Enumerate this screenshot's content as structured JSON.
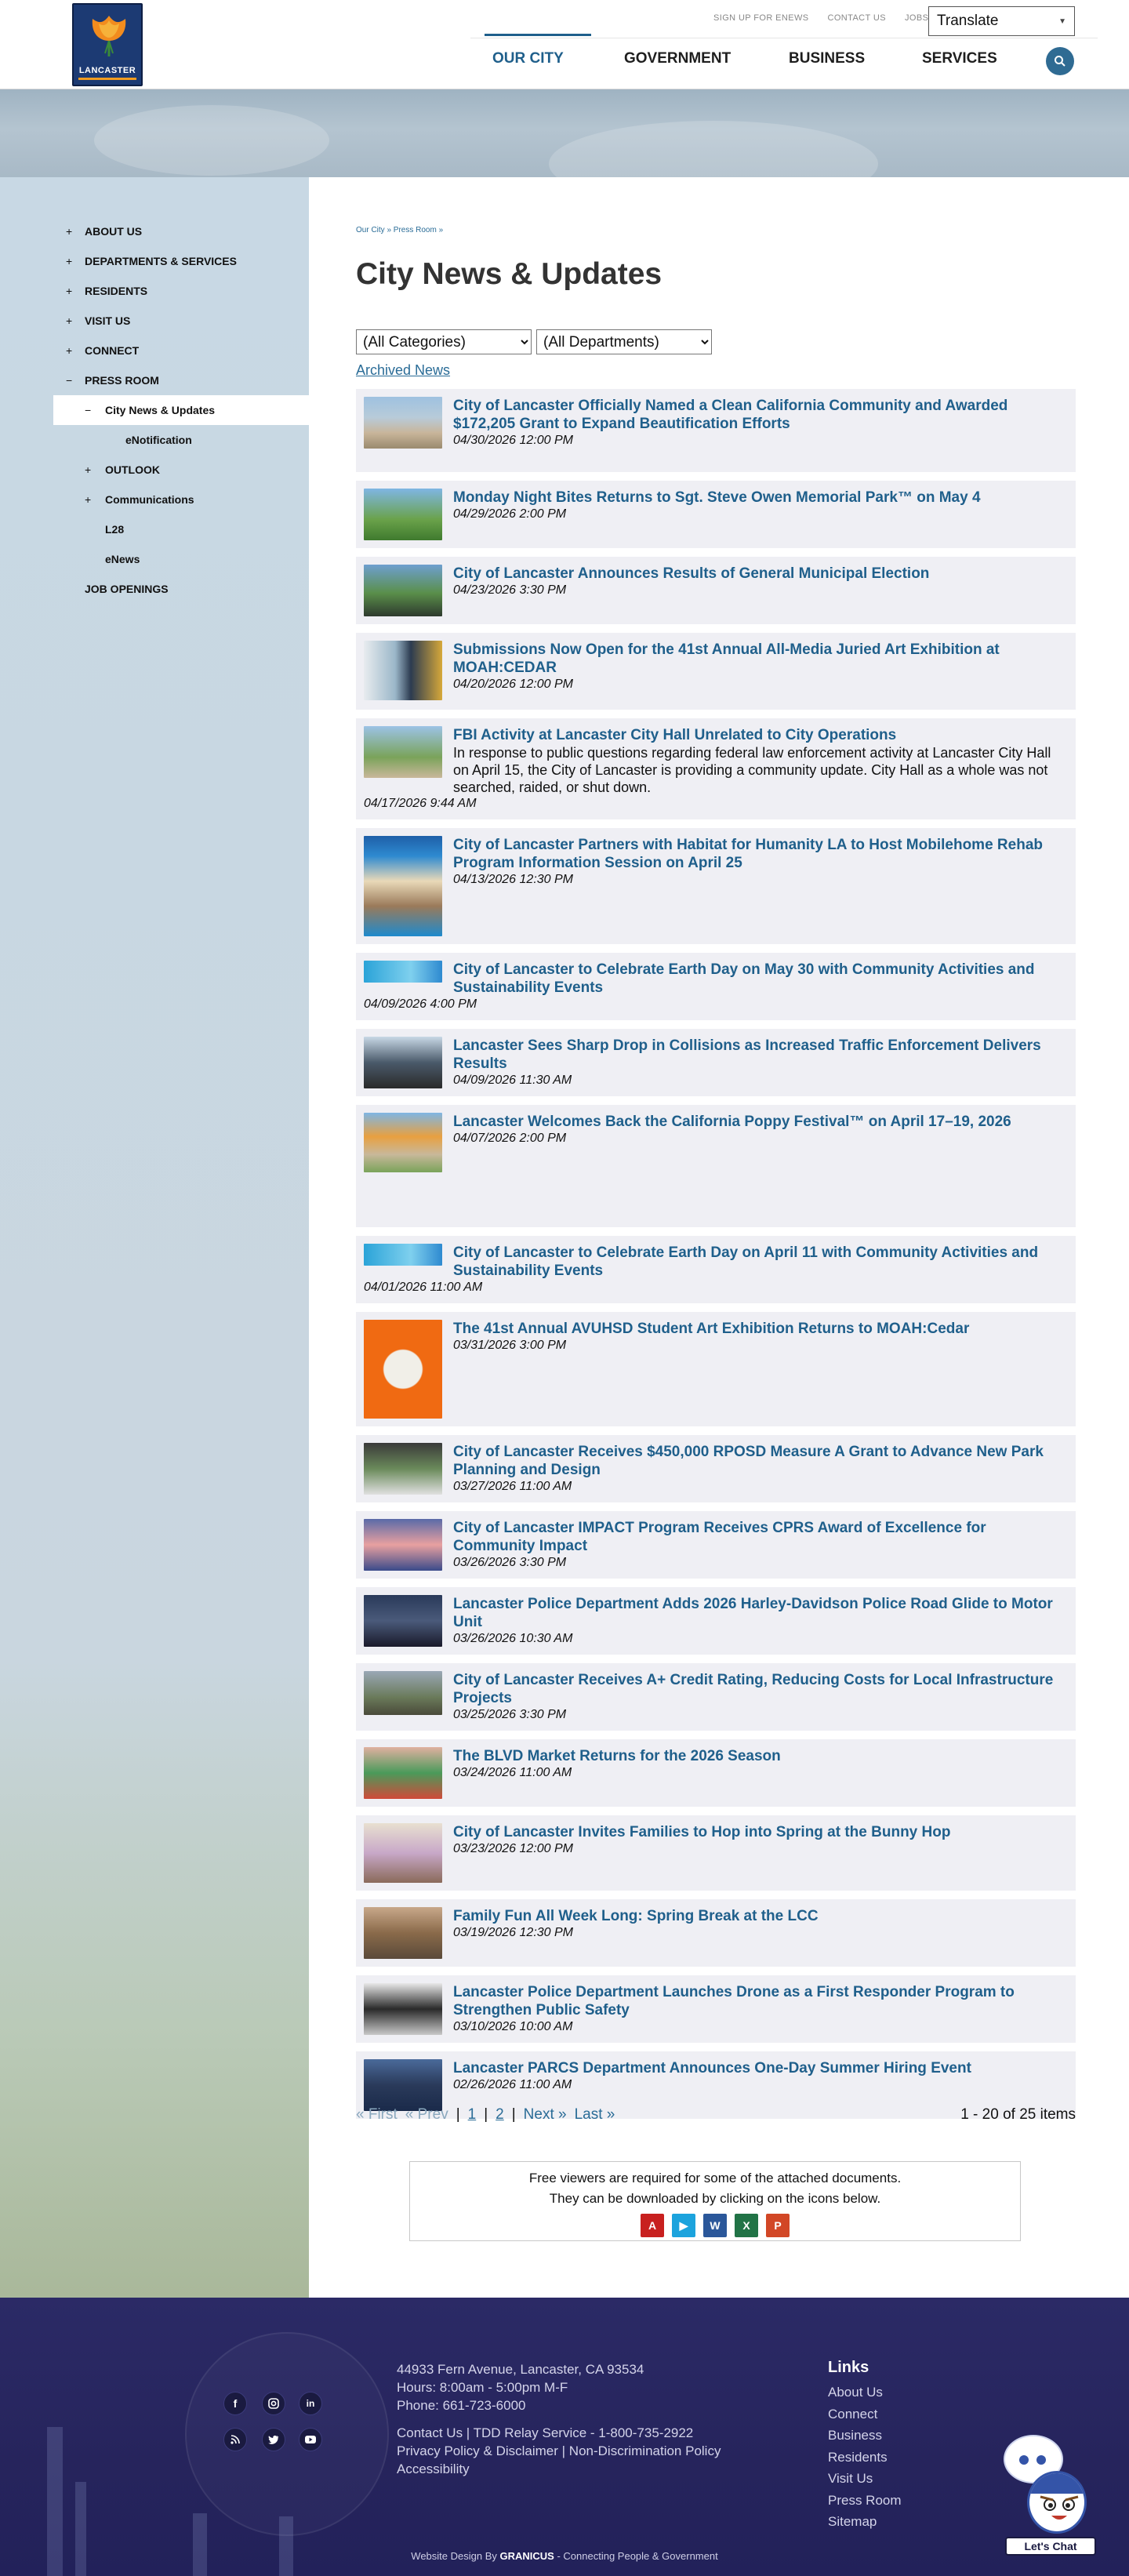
{
  "header": {
    "logo_text": "LANCASTER",
    "util_links": [
      "SIGN UP FOR ENEWS",
      "CONTACT US",
      "JOBS"
    ],
    "translate_label": "Translate",
    "nav": [
      "OUR CITY",
      "GOVERNMENT",
      "BUSINESS",
      "SERVICES"
    ],
    "search_icon": "search-icon"
  },
  "sidebar": {
    "items": [
      {
        "pm": "+",
        "label": "ABOUT US"
      },
      {
        "pm": "+",
        "label": "DEPARTMENTS & SERVICES"
      },
      {
        "pm": "+",
        "label": "RESIDENTS"
      },
      {
        "pm": "+",
        "label": "VISIT US"
      },
      {
        "pm": "+",
        "label": "CONNECT"
      },
      {
        "pm": "−",
        "label": "PRESS ROOM"
      },
      {
        "pm": "−",
        "label": "City News & Updates"
      },
      {
        "pm": "",
        "label": "eNotification"
      },
      {
        "pm": "+",
        "label": "OUTLOOK"
      },
      {
        "pm": "+",
        "label": "Communications"
      },
      {
        "pm": "",
        "label": "L28"
      },
      {
        "pm": "",
        "label": "eNews"
      },
      {
        "pm": "",
        "label": "JOB OPENINGS"
      }
    ]
  },
  "content": {
    "breadcrumb": "Our City » Press Room »",
    "title": "City News & Updates",
    "filter_categories": "(All Categories)",
    "filter_departments": "(All Departments)",
    "archived_label": "Archived News",
    "news": [
      {
        "title": "City of Lancaster Officially Named a Clean California Community and Awarded $172,205 Grant to Expand Beautification Efforts",
        "date": "04/30/2026 12:00 PM",
        "desc": ""
      },
      {
        "title": "Monday Night Bites Returns to Sgt. Steve Owen Memorial Park™ on May 4",
        "date": "04/29/2026 2:00 PM",
        "desc": ""
      },
      {
        "title": "City of Lancaster Announces Results of General Municipal Election",
        "date": "04/23/2026 3:30 PM",
        "desc": ""
      },
      {
        "title": "Submissions Now Open for the 41st Annual All-Media Juried Art Exhibition at MOAH:CEDAR",
        "date": "04/20/2026 12:00 PM",
        "desc": ""
      },
      {
        "title": "FBI Activity at Lancaster City Hall Unrelated to City Operations",
        "date": "04/17/2026 9:44 AM",
        "desc": "In response to public questions regarding federal law enforcement activity at Lancaster City Hall on April 15, the City of Lancaster is providing a community update. City Hall as a whole was not searched, raided, or shut down."
      },
      {
        "title": "City of Lancaster Partners with Habitat for Humanity LA to Host Mobilehome Rehab Program Information Session on April 25",
        "date": "04/13/2026 12:30 PM",
        "desc": ""
      },
      {
        "title": "City of Lancaster to Celebrate Earth Day on May 30 with Community Activities and Sustainability Events",
        "date": "04/09/2026 4:00 PM",
        "desc": ""
      },
      {
        "title": "Lancaster Sees Sharp Drop in Collisions as Increased Traffic Enforcement Delivers Results",
        "date": "04/09/2026 11:30 AM",
        "desc": ""
      },
      {
        "title": "Lancaster Welcomes Back the California Poppy Festival™ on April 17–19, 2026",
        "date": "04/07/2026 2:00 PM",
        "desc": ""
      },
      {
        "title": "City of Lancaster to Celebrate Earth Day on April 11 with Community Activities and Sustainability Events",
        "date": "04/01/2026 11:00 AM",
        "desc": ""
      },
      {
        "title": "The 41st Annual AVUHSD Student Art Exhibition Returns to MOAH:Cedar",
        "date": "03/31/2026 3:00 PM",
        "desc": ""
      },
      {
        "title": "City of Lancaster Receives $450,000 RPOSD Measure A Grant to Advance New Park Planning and Design",
        "date": "03/27/2026 11:00 AM",
        "desc": ""
      },
      {
        "title": "City of Lancaster IMPACT Program Receives CPRS Award of Excellence for Community Impact",
        "date": "03/26/2026 3:30 PM",
        "desc": ""
      },
      {
        "title": "Lancaster Police Department Adds 2026 Harley-Davidson Police Road Glide to Motor Unit",
        "date": "03/26/2026 10:30 AM",
        "desc": ""
      },
      {
        "title": "City of Lancaster Receives A+ Credit Rating, Reducing Costs for Local Infrastructure Projects",
        "date": "03/25/2026 3:30 PM",
        "desc": ""
      },
      {
        "title": "The BLVD Market Returns for the 2026 Season",
        "date": "03/24/2026 11:00 AM",
        "desc": ""
      },
      {
        "title": "City of Lancaster Invites Families to Hop into Spring at the Bunny Hop",
        "date": "03/23/2026 12:00 PM",
        "desc": ""
      },
      {
        "title": "Family Fun All Week Long: Spring Break at the LCC",
        "date": "03/19/2026 12:30 PM",
        "desc": ""
      },
      {
        "title": "Lancaster Police Department Launches Drone as a First Responder Program to Strengthen Public Safety",
        "date": "03/10/2026 10:00 AM",
        "desc": ""
      },
      {
        "title": "Lancaster PARCS Department Announces One-Day Summer Hiring Event",
        "date": "02/26/2026 11:00 AM",
        "desc": ""
      }
    ],
    "pager": {
      "first": "« First",
      "prev": "« Prev",
      "pages": [
        "1",
        "2"
      ],
      "next": "Next »",
      "last": "Last »",
      "count": "1 - 20 of 25 items"
    },
    "viewers": {
      "line1": "Free viewers are required for some of the attached documents.",
      "line2": "They can be downloaded by clicking on the icons below."
    }
  },
  "footer": {
    "address": "44933 Fern Avenue, Lancaster, CA 93534",
    "hours": "Hours: 8:00am - 5:00pm M-F",
    "phone": "Phone: 661-723-6000",
    "contact_line": "Contact Us | TDD Relay Service - 1-800-735-2922",
    "policy_line": "Privacy Policy & Disclaimer | Non-Discrimination Policy",
    "accessibility": "Accessibility",
    "links_heading": "Links",
    "links": [
      "About Us",
      "Connect",
      "Business",
      "Residents",
      "Visit Us",
      "Press Room",
      "Sitemap"
    ],
    "credit_prefix": "Website Design By",
    "credit_brand": "GRANICUS",
    "credit_suffix": "- Connecting People & Government",
    "chat_label": "Let's Chat"
  },
  "colors": {
    "accent": "#1f5f8b",
    "footer_bg": "#2b2a66",
    "sidebar_bg": "#c8d8e4",
    "news_bg": "#efeff4"
  }
}
